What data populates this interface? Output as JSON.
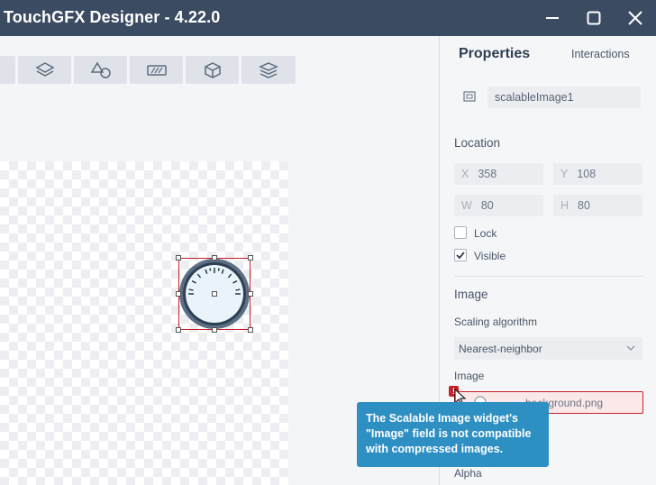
{
  "window": {
    "title": "TouchGFX Designer - 4.22.0",
    "minimize_icon": "minimize-icon",
    "maximize_icon": "maximize-icon",
    "close_icon": "close-icon"
  },
  "toolbar": {
    "buttons": [
      {
        "icon": "layers-icon"
      },
      {
        "icon": "shapes-icon"
      },
      {
        "icon": "striped-rect-icon"
      },
      {
        "icon": "cube-icon"
      },
      {
        "icon": "stack-icon"
      }
    ]
  },
  "properties": {
    "tabs": [
      "Properties",
      "Interactions"
    ],
    "widget_name": "scalableImage1",
    "location": {
      "heading": "Location",
      "x_label": "X",
      "x_value": "358",
      "y_label": "Y",
      "y_value": "108",
      "w_label": "W",
      "w_value": "80",
      "h_label": "H",
      "h_value": "80",
      "lock_label": "Lock",
      "lock_checked": false,
      "visible_label": "Visible",
      "visible_checked": true
    },
    "image_section": {
      "heading": "Image",
      "scaling_label": "Scaling algorithm",
      "scaling_value": "Nearest-neighbor",
      "image_label": "Image",
      "image_value": "...background.png",
      "alpha_label": "Alpha"
    }
  },
  "error": {
    "badge": "!",
    "tooltip": "The Scalable Image widget's \"Image\" field is not compatible with compressed images."
  },
  "colors": {
    "titlebar": "#3b4b62",
    "accent_error": "#c8202a",
    "tooltip_bg": "#2e8fc3"
  }
}
